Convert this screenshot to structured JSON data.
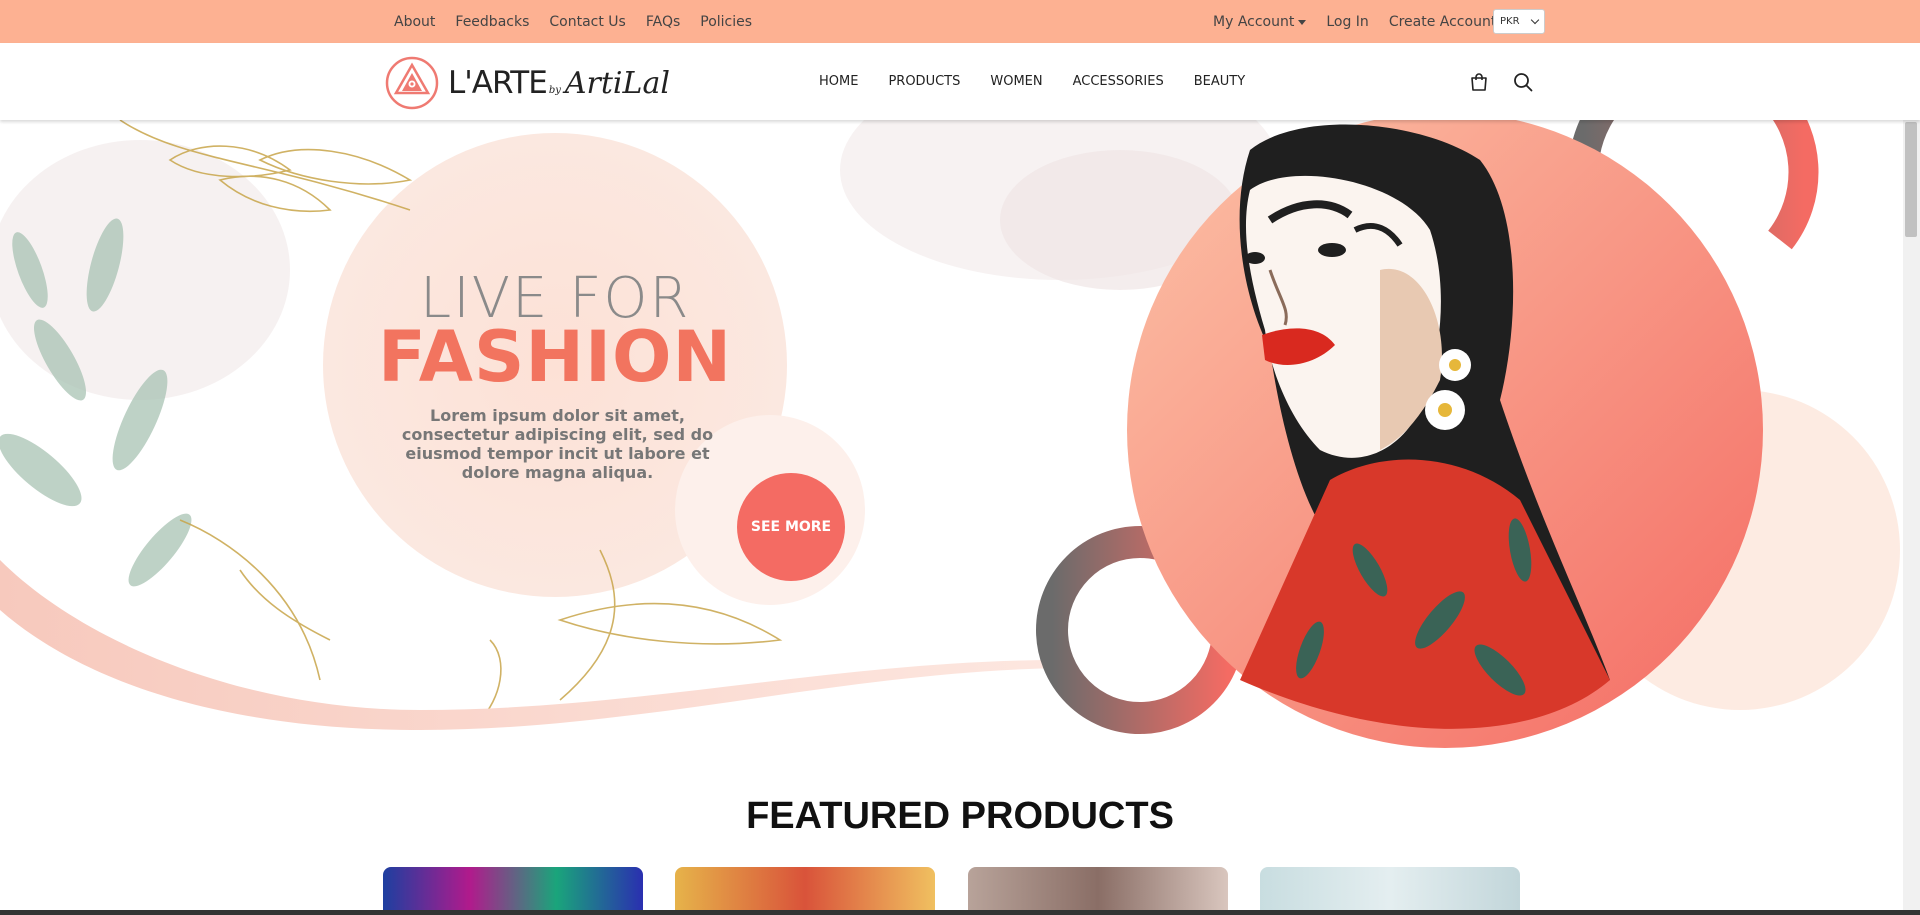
{
  "topbar": {
    "links": [
      "About",
      "Feedbacks",
      "Contact Us",
      "FAQs",
      "Policies"
    ],
    "my_account": "My Account",
    "login": "Log In",
    "create_account": "Create Account",
    "currency": "PKR",
    "bg_color": "#fdb192"
  },
  "header": {
    "logo_text": "L'ARTE",
    "logo_by": "by",
    "logo_signature": "ArtiLal",
    "nav": [
      "HOME",
      "PRODUCTS",
      "WOMEN",
      "ACCESSORIES",
      "BEAUTY"
    ],
    "icons": [
      "cart-icon",
      "search-icon"
    ]
  },
  "hero": {
    "title_line1": "LIVE FOR",
    "title_line2": "FASHION",
    "text": "Lorem ipsum dolor sit amet, consectetur adipiscing elit, sed do eiusmod tempor incit ut labore et dolore magna aliqua.",
    "button": "SEE MORE",
    "accent_color": "#f46b63"
  },
  "featured": {
    "title": "FEATURED PRODUCTS"
  }
}
